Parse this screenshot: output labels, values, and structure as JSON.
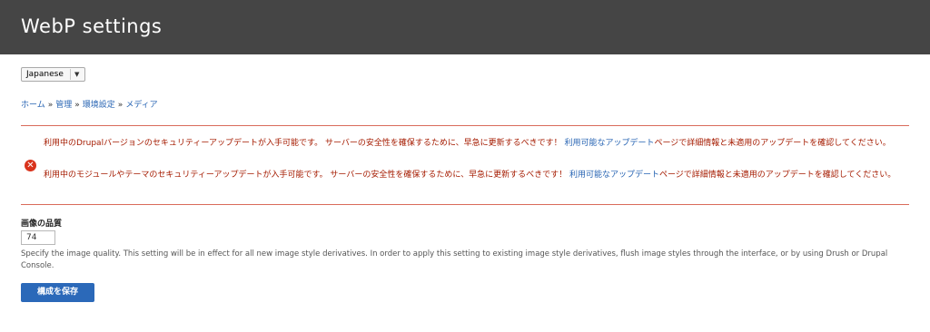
{
  "header": {
    "title": "WebP settings"
  },
  "language_switcher": {
    "selected": "Japanese"
  },
  "breadcrumb": [
    {
      "label": "ホーム"
    },
    {
      "label": "管理"
    },
    {
      "label": "環境設定"
    },
    {
      "label": "メディア"
    }
  ],
  "breadcrumb_separator": "»",
  "messages": [
    {
      "prefix": "利用中のDrupalバージョンのセキュリティーアップデートが入手可能です。 サーバーの安全性を確保するために、早急に更新するべきです！ ",
      "link": "利用可能なアップデート",
      "suffix": "ページで詳細情報と未適用のアップデートを確認してください。"
    },
    {
      "prefix": "利用中のモジュールやテーマのセキュリティーアップデートが入手可能です。 サーバーの安全性を確保するために、早急に更新するべきです！ ",
      "link": "利用可能なアップデート",
      "suffix": "ページで詳細情報と未適用のアップデートを確認してください。"
    }
  ],
  "form": {
    "quality_label": "画像の品質",
    "quality_value": "74",
    "description": "Specify the image quality. This setting will be in effect for all new image style derivatives. In order to apply this setting to existing image style derivatives, flush image styles through the interface, or by using Drush or Drupal Console.",
    "save_label": "構成を保存"
  },
  "colors": {
    "header_bg": "#454545",
    "error_text": "#a51b00",
    "link": "#2764b3",
    "primary_button": "#2b69b9"
  }
}
